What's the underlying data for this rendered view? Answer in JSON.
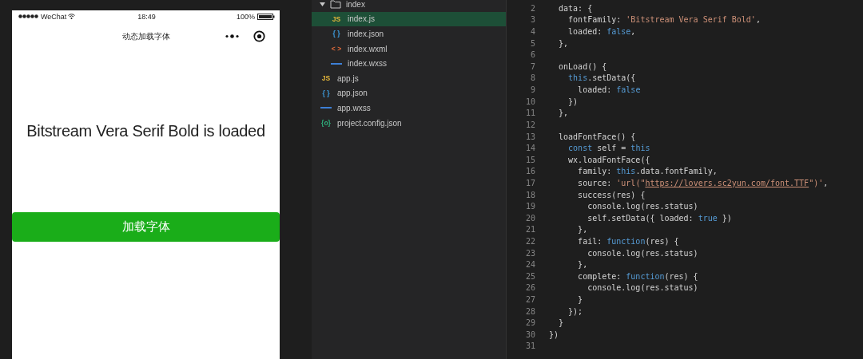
{
  "phone": {
    "status_bar": {
      "carrier": "WeChat",
      "time": "18:49",
      "battery": "100%"
    },
    "nav_bar": {
      "title": "动态加载字体"
    },
    "message": "Bitstream Vera Serif Bold is loaded",
    "button": "加载字体"
  },
  "file_tree": [
    {
      "label": "index",
      "kind": "folder",
      "expanded": true,
      "selected": false,
      "children": [
        {
          "label": "index.js",
          "kind": "js",
          "icon_label": "JS",
          "selected": true
        },
        {
          "label": "index.json",
          "kind": "json",
          "icon_label": "{ }",
          "selected": false
        },
        {
          "label": "index.wxml",
          "kind": "wxml",
          "icon_label": "< >",
          "selected": false
        },
        {
          "label": "index.wxss",
          "kind": "wxss",
          "selected": false
        }
      ]
    },
    {
      "label": "app.js",
      "kind": "js",
      "icon_label": "JS",
      "selected": false
    },
    {
      "label": "app.json",
      "kind": "json",
      "icon_label": "{ }",
      "selected": false
    },
    {
      "label": "app.wxss",
      "kind": "wxss",
      "selected": false
    },
    {
      "label": "project.config.json",
      "kind": "config",
      "icon_label": "{o}",
      "selected": false
    }
  ],
  "code": [
    {
      "number": "2",
      "tokens": [
        {
          "text": "  data: {",
          "kind": "plain"
        }
      ]
    },
    {
      "number": "3",
      "tokens": [
        {
          "text": "    fontFamily: ",
          "kind": "plain"
        },
        {
          "text": "'Bitstream Vera Serif Bold'",
          "kind": "string"
        },
        {
          "text": ",",
          "kind": "plain"
        }
      ]
    },
    {
      "number": "4",
      "tokens": [
        {
          "text": "    loaded: ",
          "kind": "plain"
        },
        {
          "text": "false",
          "kind": "keyword"
        },
        {
          "text": ",",
          "kind": "plain"
        }
      ]
    },
    {
      "number": "5",
      "tokens": [
        {
          "text": "  },",
          "kind": "plain"
        }
      ]
    },
    {
      "number": "6"
    },
    {
      "number": "7",
      "tokens": [
        {
          "text": "  onLoad() {",
          "kind": "plain"
        }
      ]
    },
    {
      "number": "8",
      "tokens": [
        {
          "text": "    this",
          "kind": "keyword"
        },
        {
          "text": ".setData({",
          "kind": "plain"
        }
      ]
    },
    {
      "number": "9",
      "tokens": [
        {
          "text": "      loaded: ",
          "kind": "plain"
        },
        {
          "text": "false",
          "kind": "keyword"
        }
      ]
    },
    {
      "number": "10",
      "tokens": [
        {
          "text": "    })",
          "kind": "plain"
        }
      ]
    },
    {
      "number": "11",
      "tokens": [
        {
          "text": "  },",
          "kind": "plain"
        }
      ]
    },
    {
      "number": "12"
    },
    {
      "number": "13",
      "tokens": [
        {
          "text": "  loadFontFace() {",
          "kind": "plain"
        }
      ]
    },
    {
      "number": "14",
      "tokens": [
        {
          "text": "    const",
          "kind": "keyword"
        },
        {
          "text": " self = ",
          "kind": "plain"
        },
        {
          "text": "this",
          "kind": "keyword"
        }
      ]
    },
    {
      "number": "15",
      "tokens": [
        {
          "text": "    wx.loadFontFace({",
          "kind": "plain"
        }
      ]
    },
    {
      "number": "16",
      "tokens": [
        {
          "text": "      family: ",
          "kind": "plain"
        },
        {
          "text": "this",
          "kind": "keyword"
        },
        {
          "text": ".data.fontFamily,",
          "kind": "plain"
        }
      ]
    },
    {
      "number": "17",
      "tokens": [
        {
          "text": "      source: ",
          "kind": "plain"
        },
        {
          "text": "'url(\"",
          "kind": "string"
        },
        {
          "text": "https://lovers.sc2yun.com/font.TTF",
          "kind": "url"
        },
        {
          "text": "\")'",
          "kind": "string"
        },
        {
          "text": ",",
          "kind": "plain"
        }
      ]
    },
    {
      "number": "18",
      "tokens": [
        {
          "text": "      success(res) {",
          "kind": "plain"
        }
      ]
    },
    {
      "number": "19",
      "tokens": [
        {
          "text": "        console.log(res.status)",
          "kind": "plain"
        }
      ]
    },
    {
      "number": "20",
      "tokens": [
        {
          "text": "        self.setData({ loaded: ",
          "kind": "plain"
        },
        {
          "text": "true",
          "kind": "keyword"
        },
        {
          "text": " })",
          "kind": "plain"
        }
      ]
    },
    {
      "number": "21",
      "tokens": [
        {
          "text": "      },",
          "kind": "plain"
        }
      ]
    },
    {
      "number": "22",
      "tokens": [
        {
          "text": "      fail: ",
          "kind": "plain"
        },
        {
          "text": "function",
          "kind": "keyword"
        },
        {
          "text": "(res) {",
          "kind": "plain"
        }
      ]
    },
    {
      "number": "23",
      "tokens": [
        {
          "text": "        console.log(res.status)",
          "kind": "plain"
        }
      ]
    },
    {
      "number": "24",
      "tokens": [
        {
          "text": "      },",
          "kind": "plain"
        }
      ]
    },
    {
      "number": "25",
      "tokens": [
        {
          "text": "      complete: ",
          "kind": "plain"
        },
        {
          "text": "function",
          "kind": "keyword"
        },
        {
          "text": "(res) {",
          "kind": "plain"
        }
      ]
    },
    {
      "number": "26",
      "tokens": [
        {
          "text": "        console.log(res.status)",
          "kind": "plain"
        }
      ]
    },
    {
      "number": "27",
      "tokens": [
        {
          "text": "      }",
          "kind": "plain"
        }
      ]
    },
    {
      "number": "28",
      "tokens": [
        {
          "text": "    });",
          "kind": "plain"
        }
      ]
    },
    {
      "number": "29",
      "tokens": [
        {
          "text": "  }",
          "kind": "plain"
        }
      ]
    },
    {
      "number": "30",
      "tokens": [
        {
          "text": "})",
          "kind": "plain"
        }
      ]
    },
    {
      "number": "31"
    }
  ]
}
